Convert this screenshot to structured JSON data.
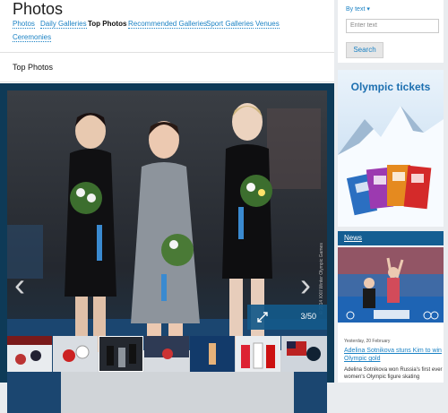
{
  "header": {
    "title": "Photos"
  },
  "nav": {
    "items": [
      {
        "label": "Photos",
        "active": false
      },
      {
        "label": "Daily Galleries",
        "active": false
      },
      {
        "label": "Top Photos",
        "active": true
      },
      {
        "label": "Recommended Galleries",
        "active": false
      },
      {
        "label": "Sport Galleries",
        "active": false
      },
      {
        "label": "Venues",
        "active": false
      },
      {
        "label": "Ceremonies",
        "active": false
      }
    ]
  },
  "section": {
    "title": "Top Photos"
  },
  "gallery": {
    "counter": "3/50",
    "copyright": "© 2014 XXII Winter Olympic Games",
    "thumbnail_count": 7,
    "colors": {
      "frame": "#0e3a57",
      "counter_bg": "#135989"
    }
  },
  "search": {
    "filter_label": "By text ▾",
    "placeholder": "Enter text",
    "button_label": "Search"
  },
  "ad": {
    "title": "Olympic tickets"
  },
  "news": {
    "heading": "News",
    "date": "Yesterday, 20 February",
    "headline": "Adelina Sotnikova stuns Kim to win Olympic gold",
    "summary": "Adelina Sotnikova won Russia's first ever women's Olympic figure skating"
  },
  "colors": {
    "link": "#1b82c4",
    "news_header": "#145e92",
    "ad_title": "#1c6fb0"
  }
}
